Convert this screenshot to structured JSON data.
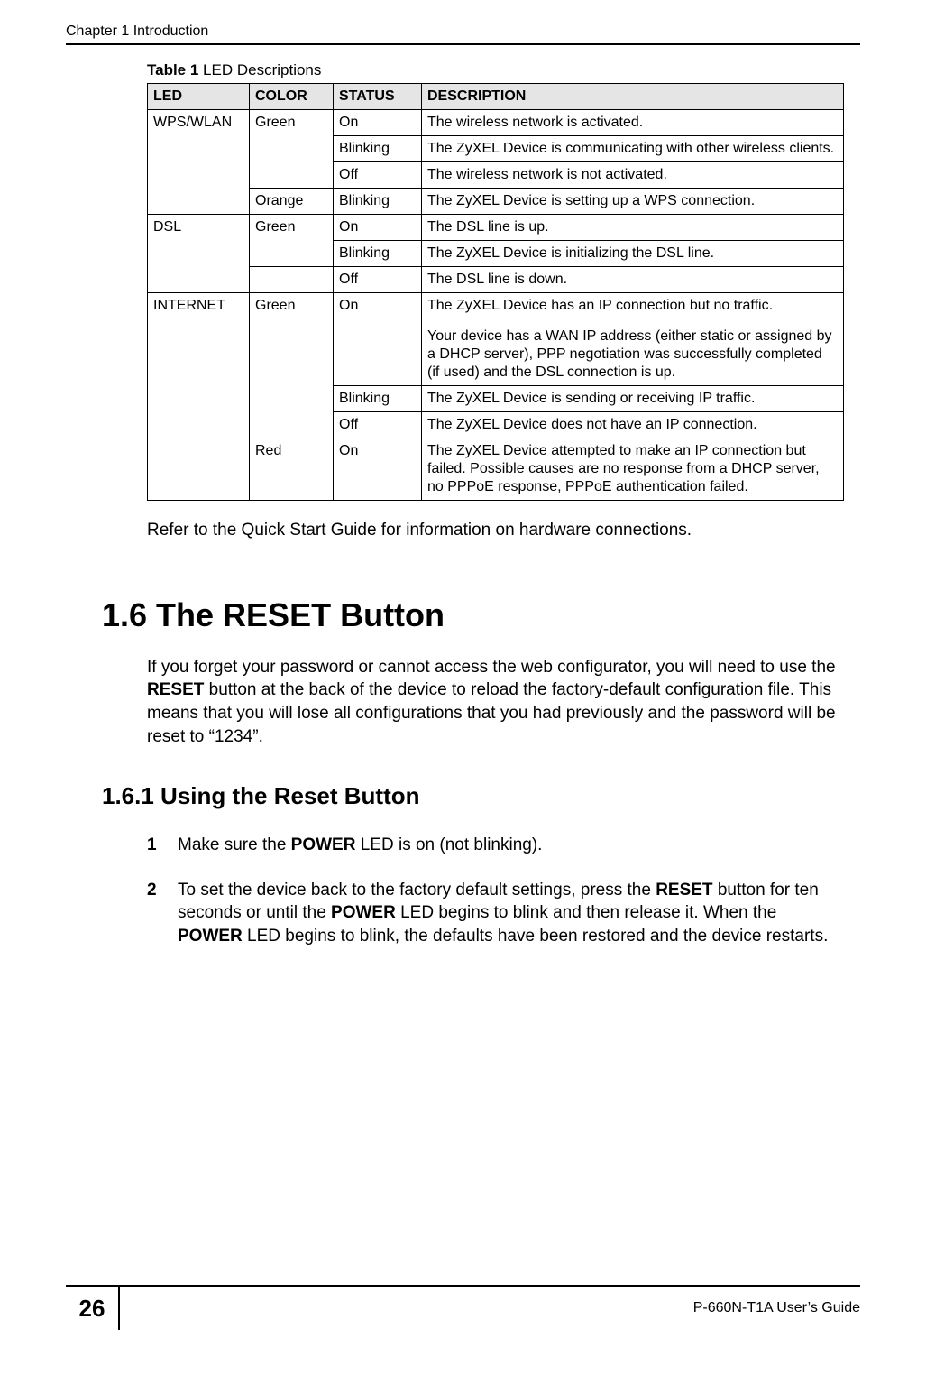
{
  "running_head": "Chapter 1 Introduction",
  "table": {
    "caption_bold": "Table 1",
    "caption_rest": "   LED Descriptions",
    "headers": [
      "LED",
      "COLOR",
      "STATUS",
      "DESCRIPTION"
    ],
    "wps_led": "WPS/WLAN",
    "wps_color1": "Green",
    "wps_r1_status": "On",
    "wps_r1_desc": "The wireless network is activated.",
    "wps_r2_status": "Blinking",
    "wps_r2_desc": "The ZyXEL Device is communicating with other wireless clients.",
    "wps_r3_status": "Off",
    "wps_r3_desc": "The wireless network is not activated.",
    "wps_color2": "Orange",
    "wps_r4_status": "Blinking",
    "wps_r4_desc": "The ZyXEL Device is setting up a WPS connection.",
    "dsl_led": "DSL",
    "dsl_color": "Green",
    "dsl_r1_status": "On",
    "dsl_r1_desc": "The DSL line is up.",
    "dsl_r2_status": "Blinking",
    "dsl_r2_desc": "The ZyXEL Device is initializing the DSL line.",
    "dsl_r3_status": "Off",
    "dsl_r3_desc": "The DSL line is down.",
    "int_led": "INTERNET",
    "int_color1": "Green",
    "int_r1_status": "On",
    "int_r1_desc_p1": "The ZyXEL Device has an IP connection but no traffic.",
    "int_r1_desc_p2": "Your device has a WAN IP address (either static or assigned by a DHCP server), PPP negotiation was successfully completed (if used) and the DSL connection is up.",
    "int_r2_status": "Blinking",
    "int_r2_desc": "The ZyXEL Device is sending or receiving IP traffic.",
    "int_r3_status": "Off",
    "int_r3_desc": "The ZyXEL Device does not have an IP connection.",
    "int_color2": "Red",
    "int_r4_status": "On",
    "int_r4_desc": "The ZyXEL Device attempted to make an IP connection but failed. Possible causes are no response from a DHCP server, no PPPoE response, PPPoE authentication failed."
  },
  "after_table": "Refer to the Quick Start Guide for information on hardware connections.",
  "section_heading": "1.6  The RESET Button",
  "section_para_parts": {
    "p1a": "If you forget your password or cannot access the web configurator, you will need to use the ",
    "p1b": "RESET",
    "p1c": " button at the back of the device to reload the factory-default configuration file. This means that you will lose all configurations that you had previously and the password will be reset to “1234”."
  },
  "subsection_heading": "1.6.1  Using the Reset Button",
  "steps": {
    "s1a": "Make sure the ",
    "s1b": "POWER",
    "s1c": " LED is on (not blinking).",
    "s2a": "To set the device back to the factory default settings, press the ",
    "s2b": "RESET",
    "s2c": " button for ten seconds or until the ",
    "s2d": "POWER",
    "s2e": " LED begins to blink and then release it. When the ",
    "s2f": "POWER",
    "s2g": " LED begins to blink, the defaults have been restored and the device restarts."
  },
  "page_number": "26",
  "footer_right": "P-660N-T1A User’s Guide"
}
